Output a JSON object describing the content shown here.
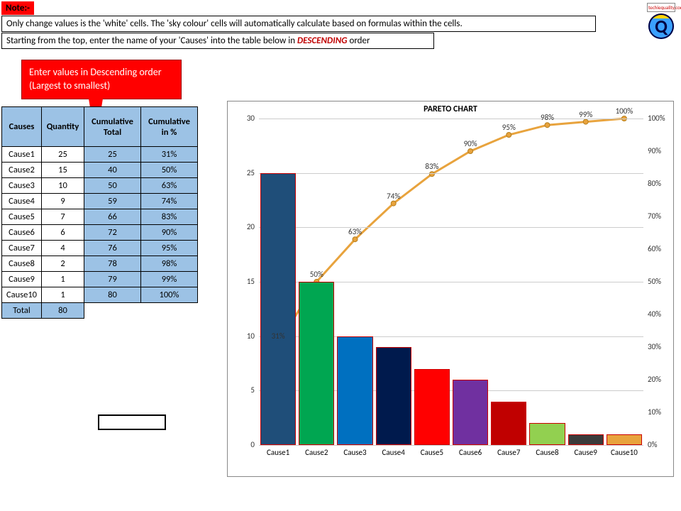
{
  "note_label": "Note:-",
  "instruction1": "Only change values is the 'white' cells. The 'sky colour' cells will automatically calculate based on formulas within the cells.",
  "instruction2_prefix": "Starting from the top, enter the name of your 'Causes' into the table below in ",
  "instruction2_desc": "DESCENDING",
  "instruction2_suffix": " order",
  "callout_line1": "Enter values in Descending order",
  "callout_line2": "(Largest to smallest)",
  "logo_top": "techiequality.com",
  "logo_letter": "Q",
  "headers": {
    "causes": "Causes",
    "quantity": "Quantity",
    "cum_total": "Cumulative Total",
    "cum_pct": "Cumulative in %"
  },
  "rows": [
    {
      "cause": "Cause1",
      "qty": "25",
      "ctot": "25",
      "cpct": "31%"
    },
    {
      "cause": "Cause2",
      "qty": "15",
      "ctot": "40",
      "cpct": "50%"
    },
    {
      "cause": "Cause3",
      "qty": "10",
      "ctot": "50",
      "cpct": "63%"
    },
    {
      "cause": "Cause4",
      "qty": "9",
      "ctot": "59",
      "cpct": "74%"
    },
    {
      "cause": "Cause5",
      "qty": "7",
      "ctot": "66",
      "cpct": "83%"
    },
    {
      "cause": "Cause6",
      "qty": "6",
      "ctot": "72",
      "cpct": "90%"
    },
    {
      "cause": "Cause7",
      "qty": "4",
      "ctot": "76",
      "cpct": "95%"
    },
    {
      "cause": "Cause8",
      "qty": "2",
      "ctot": "78",
      "cpct": "98%"
    },
    {
      "cause": "Cause9",
      "qty": "1",
      "ctot": "79",
      "cpct": "99%"
    },
    {
      "cause": "Cause10",
      "qty": "1",
      "ctot": "80",
      "cpct": "100%"
    }
  ],
  "total_label": "Total",
  "total_value": "80",
  "chart_title": "PARETO CHART",
  "chart_data": {
    "type": "bar",
    "title": "PARETO CHART",
    "categories": [
      "Cause1",
      "Cause2",
      "Cause3",
      "Cause4",
      "Cause5",
      "Cause6",
      "Cause7",
      "Cause8",
      "Cause9",
      "Cause10"
    ],
    "series": [
      {
        "name": "Quantity",
        "type": "bar",
        "values": [
          25,
          15,
          10,
          9,
          7,
          6,
          4,
          2,
          1,
          1
        ],
        "colors": [
          "#1f4e79",
          "#00a651",
          "#0070c0",
          "#001a4d",
          "#ff0000",
          "#7030a0",
          "#c00000",
          "#92d050",
          "#3b3b3b",
          "#e8a33d"
        ]
      },
      {
        "name": "Cumulative %",
        "type": "line",
        "values": [
          31,
          50,
          63,
          74,
          83,
          90,
          95,
          98,
          99,
          100
        ],
        "labels": [
          "31%",
          "50%",
          "63%",
          "74%",
          "83%",
          "90%",
          "95%",
          "98%",
          "99%",
          "100%"
        ]
      }
    ],
    "y_left": {
      "min": 0,
      "max": 30,
      "ticks": [
        0,
        5,
        10,
        15,
        20,
        25,
        30
      ]
    },
    "y_right": {
      "min": 0,
      "max": 100,
      "ticks": [
        0,
        10,
        20,
        30,
        40,
        50,
        60,
        70,
        80,
        90,
        100
      ],
      "suffix": "%"
    },
    "xlabel": "",
    "ylabel": ""
  }
}
